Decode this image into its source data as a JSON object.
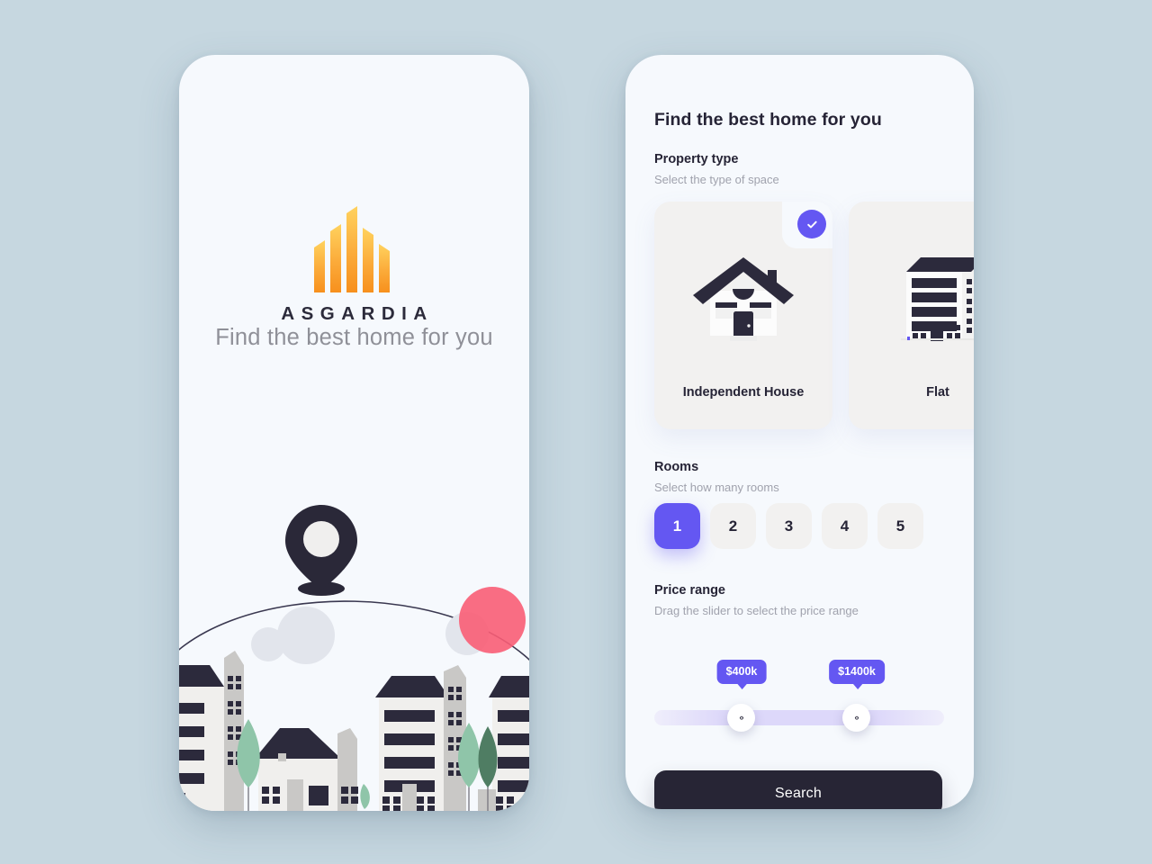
{
  "theme": {
    "canvas_bg": "#c6d7e0",
    "screen_bg": "#f6f9fd",
    "accent_purple": "#6457f2",
    "dark": "#262436",
    "card_bg": "#f2f1f0",
    "muted_text": "#a0a2ad",
    "logo_gradient_top": "#ffce54",
    "logo_gradient_bottom": "#f7941e",
    "illustration_pink": "#fa5d76",
    "illustration_grey_circle": "#e2e5ec",
    "tree_green_light": "#8fc5a9",
    "tree_green_dark": "#4f7d63",
    "building_body": "#f0efed",
    "building_side": "#c9c8c6"
  },
  "splash_screen": {
    "logo_name": "logo-mark-buildings",
    "brand_name": "ASGARDIA",
    "tagline": "Find the best home for you",
    "illustration": {
      "name": "city-map-pin-illustration",
      "pin_icon": "location-pin-icon",
      "arc": "globe-arc",
      "circles": [
        "grey-circle-small",
        "grey-circle-large",
        "grey-circle-right",
        "pink-circle"
      ],
      "buildings": "city-skyline",
      "trees": "trees"
    }
  },
  "filter_screen": {
    "title": "Find the best home for you",
    "property_type": {
      "heading": "Property type",
      "subheading": "Select the type of space",
      "selected_index": 0,
      "check_icon": "check-icon",
      "options": [
        {
          "label": "Independent House",
          "icon": "house-icon",
          "selected": true
        },
        {
          "label": "Flat",
          "icon": "apartment-building-icon",
          "selected": false
        }
      ]
    },
    "rooms": {
      "heading": "Rooms",
      "subheading": "Select how many rooms",
      "options": [
        "1",
        "2",
        "3",
        "4",
        "5"
      ],
      "selected": "1"
    },
    "price_range": {
      "heading": "Price range",
      "subheading": "Drag the slider to select the price range",
      "min_label": "$400k",
      "max_label": "$1400k",
      "handle_glyph": "‹›"
    },
    "search_label": "Search"
  }
}
